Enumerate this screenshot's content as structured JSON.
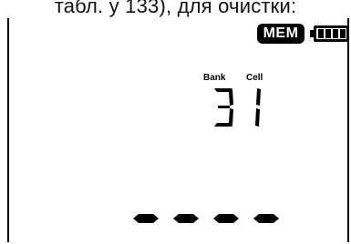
{
  "caption": "табл. у 133), для очистки:",
  "status_bar": {
    "mem_label": "MEM",
    "battery_icon": "battery-icon",
    "battery_level_segments": 4
  },
  "display": {
    "bank_label": "Bank",
    "cell_label": "Cell",
    "bank_value": "3",
    "cell_value": "1",
    "readout": "----"
  },
  "colors": {
    "segment": "#000000",
    "background": "#ffffff"
  }
}
